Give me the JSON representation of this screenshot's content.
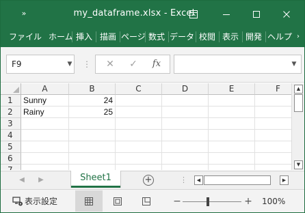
{
  "window": {
    "qat_label": "»",
    "title": "my_dataframe.xlsx  -  Excel"
  },
  "ribbon": {
    "tabs": [
      {
        "label": "ファイル"
      },
      {
        "label": "ホーム"
      },
      {
        "label": "挿入"
      },
      {
        "label": "描画"
      },
      {
        "label": "ページ"
      },
      {
        "label": "数式"
      },
      {
        "label": "データ"
      },
      {
        "label": "校閲"
      },
      {
        "label": "表示"
      },
      {
        "label": "開発"
      },
      {
        "label": "ヘルプ"
      }
    ]
  },
  "formula_bar": {
    "name_box": "F9",
    "formula": "",
    "fx_label": "fx"
  },
  "grid": {
    "columns": [
      "A",
      "B",
      "C",
      "D",
      "E",
      "F"
    ],
    "rows": [
      {
        "num": "1",
        "A": "Sunny",
        "B": "24"
      },
      {
        "num": "2",
        "A": "Rainy",
        "B": "25"
      },
      {
        "num": "3",
        "A": "",
        "B": ""
      },
      {
        "num": "4",
        "A": "",
        "B": ""
      },
      {
        "num": "5",
        "A": "",
        "B": ""
      },
      {
        "num": "6",
        "A": "",
        "B": ""
      },
      {
        "num": "7",
        "A": "",
        "B": ""
      }
    ]
  },
  "sheets": {
    "active": "Sheet1",
    "add_label": "+"
  },
  "status": {
    "settings_label": "表示設定",
    "zoom_minus": "−",
    "zoom_plus": "+",
    "zoom_level": "100%",
    "zoom_fraction": 0.46
  },
  "colors": {
    "accent": "#217346",
    "grid_line": "#e1e1e1",
    "header_bg": "#f2f2f2"
  }
}
